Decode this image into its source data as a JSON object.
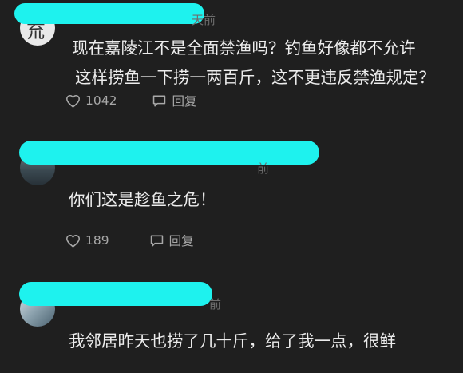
{
  "comments": [
    {
      "avatar_glyph": "㐬",
      "time_stub": "天前",
      "text_lines": [
        "现在嘉陵江不是全面禁渔吗？钓鱼好像都不允许",
        "这样捞鱼一下捞一两百斤，这不更违反禁渔规定？"
      ],
      "likes": "1042",
      "reply_label": "回复"
    },
    {
      "time_stub": "前",
      "text_lines": [
        "你们这是趁鱼之危！"
      ],
      "likes": "189",
      "reply_label": "回复"
    },
    {
      "time_stub": "前",
      "text_lines": [
        "我邻居昨天也捞了几十斤，给了我一点，很鲜"
      ]
    }
  ],
  "icons": {
    "like": "heart-outline-icon",
    "reply": "speech-bubble-icon"
  },
  "colors": {
    "background": "#1f1f1f",
    "redaction": "#1ef2ee",
    "text": "#ececec",
    "muted": "#a8a8a8"
  }
}
